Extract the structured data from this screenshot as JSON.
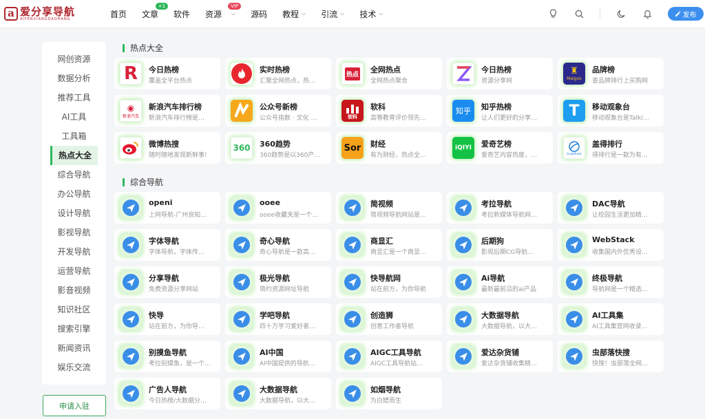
{
  "logo": {
    "mark": "a",
    "title": "爱分享导航",
    "sub": "AIFENXIANGDAOHANG"
  },
  "nav": [
    {
      "label": "首页",
      "badge": null
    },
    {
      "label": "文章",
      "badge": "+1"
    },
    {
      "label": "软件",
      "badge": null
    },
    {
      "label": "资源",
      "badge": "VIP"
    },
    {
      "label": "源码",
      "badge": null
    },
    {
      "label": "教程",
      "badge": null
    },
    {
      "label": "引流",
      "badge": null
    },
    {
      "label": "技术",
      "badge": null
    }
  ],
  "header": {
    "publish_label": "发布"
  },
  "sidebar": {
    "items": [
      "网创资源",
      "数据分析",
      "推荐工具",
      "AI工具",
      "工具箱",
      "热点大全",
      "综合导航",
      "办公导航",
      "设计导航",
      "影视导航",
      "开发导航",
      "运营导航",
      "影音视频",
      "知识社区",
      "搜索引擎",
      "新闻资讯",
      "娱乐交流"
    ],
    "active": "热点大全",
    "apply_label": "申请入驻"
  },
  "sections": {
    "hot_title": "热点大全",
    "nav_title": "综合导航"
  },
  "hot": [
    {
      "title": "今日热榜",
      "desc": "覆盖全平台热点",
      "icon": "jinri-icon"
    },
    {
      "title": "实时热榜",
      "desc": "汇聚全网热点，热…",
      "icon": "flame-icon"
    },
    {
      "title": "全网热点",
      "desc": "全网热点聚合",
      "icon": "redian-icon"
    },
    {
      "title": "今日热榜",
      "desc": "资源分享网",
      "icon": "z-logo-icon"
    },
    {
      "title": "品牌榜",
      "desc": "查品牌排行上买购网",
      "icon": "maigoo-icon"
    },
    {
      "title": "新浪汽车排行榜",
      "desc": "新浪汽车排行榜是…",
      "icon": "sina-car-icon"
    },
    {
      "title": "公众号新榜",
      "desc": "公众号指数 · 文化 …",
      "icon": "newrank-icon"
    },
    {
      "title": "软科",
      "desc": "高等教育评价领先…",
      "icon": "ruanke-icon"
    },
    {
      "title": "知乎热榜",
      "desc": "让人们更好的分享…",
      "icon": "zhihu-icon"
    },
    {
      "title": "移动观象台",
      "desc": "移动观象台是Talki…",
      "icon": "talkingdata-icon"
    },
    {
      "title": "微博热搜",
      "desc": "随时随地发现新鲜事!",
      "icon": "weibo-icon"
    },
    {
      "title": "360趋势",
      "desc": "360趋势是以360产…",
      "icon": "360-icon"
    },
    {
      "title": "财经",
      "desc": "有为财经，热点全…",
      "icon": "sor-icon"
    },
    {
      "title": "爱奇艺榜",
      "desc": "爱奇艺内容热度，…",
      "icon": "iqiyi-icon"
    },
    {
      "title": "盖得排行",
      "desc": "得排行是一款为有…",
      "icon": "guide-rank-icon"
    }
  ],
  "navsites": [
    {
      "title": "openi",
      "desc": "上网导航-广州良知…"
    },
    {
      "title": "ooee",
      "desc": "ooee收藏夹是一个…"
    },
    {
      "title": "简视频",
      "desc": "简视频导航网站是…"
    },
    {
      "title": "考拉导航",
      "desc": "考拉新媒体导航网…"
    },
    {
      "title": "DAC导航",
      "desc": "让校园生活更加精…"
    },
    {
      "title": "字体导航",
      "desc": "字体导航，字体传…"
    },
    {
      "title": "奇心导航",
      "desc": "奇心导航是一款高…"
    },
    {
      "title": "商显汇",
      "desc": "商显汇是一个商显…"
    },
    {
      "title": "后期狗",
      "desc": "影视后期CG导航…"
    },
    {
      "title": "WebStack",
      "desc": "收集国内外优秀设…"
    },
    {
      "title": "分享导航",
      "desc": "免费资源分享网站"
    },
    {
      "title": "极光导航",
      "desc": "简约资源网址导航"
    },
    {
      "title": "快导航网",
      "desc": "站在前方，为你导航"
    },
    {
      "title": "Ai导航",
      "desc": "最新最前沿的ai产品"
    },
    {
      "title": "终极导航",
      "desc": "导航网是一个精选…"
    },
    {
      "title": "快导",
      "desc": "站在前方，为你导…"
    },
    {
      "title": "学吧导航",
      "desc": "四十万学习爱好者…"
    },
    {
      "title": "创造狮",
      "desc": "创意工作者导航"
    },
    {
      "title": "大数据导航",
      "desc": "大数据导航，以大…"
    },
    {
      "title": "AI工具集",
      "desc": "AI工具集官网收录…"
    },
    {
      "title": "别摸鱼导航",
      "desc": "考拉别摸鱼，是一个…"
    },
    {
      "title": "AI中国",
      "desc": "AI中国提供的导航…"
    },
    {
      "title": "AIGC工具导航",
      "desc": "AIGC工具导航站…"
    },
    {
      "title": "爱达杂货铺",
      "desc": "爱达杂货铺收集精…"
    },
    {
      "title": "虫部落快搜",
      "desc": "快搜！虫部落全网…"
    },
    {
      "title": "广告人导航",
      "desc": "今日热榜/大数据分…"
    },
    {
      "title": "大数据导航",
      "desc": "大数据导航，以大…"
    },
    {
      "title": "如烟导航",
      "desc": "为白嫖而生"
    }
  ],
  "icon_texts": {
    "360": "360",
    "sor": "Sor",
    "iqiyi": "iQIYI",
    "zhihu": "知乎",
    "redian": "热点",
    "ruanke": "软科",
    "sina_car": "新浪汽车",
    "maigoo": "Maigoo",
    "guide": "GuideRank"
  },
  "colors": {
    "accent": "#2fb75b",
    "brand": "#b0242c",
    "publish": "#3d8fef",
    "nav_icon": "#3a8ee8"
  }
}
